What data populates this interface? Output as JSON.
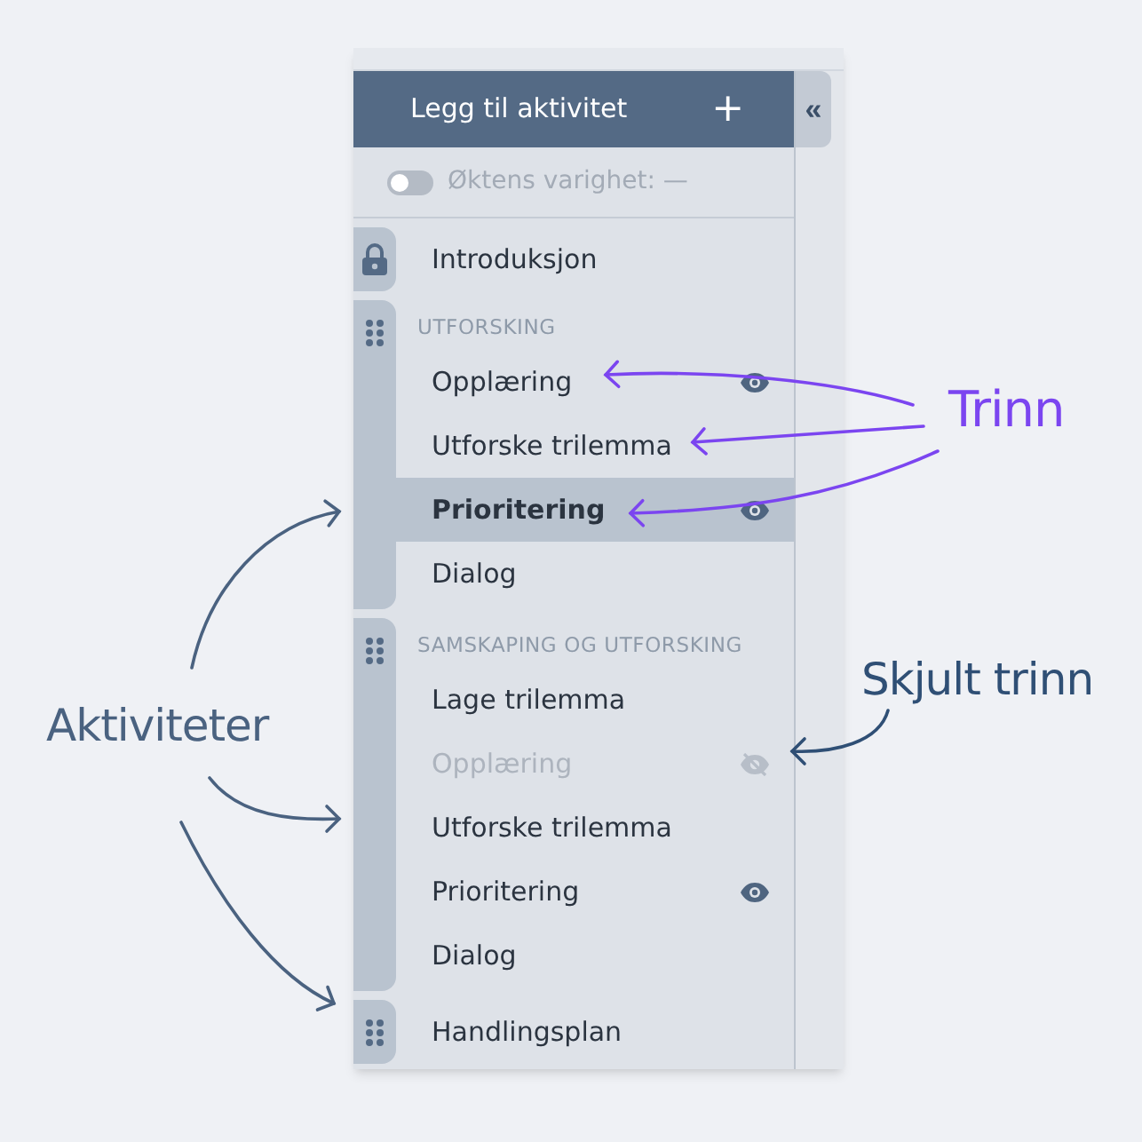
{
  "header": {
    "title": "Legg til aktivitet",
    "add_icon": "+",
    "collapse_icon": "«"
  },
  "duration_toggle": {
    "on": false,
    "label": "Øktens varighet: —"
  },
  "activities": [
    {
      "kind": "locked",
      "steps": [
        {
          "label": "Introduksjon",
          "eye_icon": false,
          "hidden": false,
          "selected": false
        }
      ]
    },
    {
      "kind": "group",
      "title": "UTFORSKING",
      "steps": [
        {
          "label": "Opplæring",
          "eye_icon": true,
          "hidden": false,
          "selected": false
        },
        {
          "label": "Utforske trilemma",
          "eye_icon": false,
          "hidden": false,
          "selected": false
        },
        {
          "label": "Prioritering",
          "eye_icon": true,
          "hidden": false,
          "selected": true
        },
        {
          "label": "Dialog",
          "eye_icon": false,
          "hidden": false,
          "selected": false
        }
      ]
    },
    {
      "kind": "group",
      "title": "SAMSKAPING OG UTFORSKING",
      "steps": [
        {
          "label": "Lage trilemma",
          "eye_icon": false,
          "hidden": false,
          "selected": false
        },
        {
          "label": "Opplæring",
          "eye_icon": true,
          "hidden": true,
          "selected": false
        },
        {
          "label": "Utforske trilemma",
          "eye_icon": false,
          "hidden": false,
          "selected": false
        },
        {
          "label": "Prioritering",
          "eye_icon": true,
          "hidden": false,
          "selected": false
        },
        {
          "label": "Dialog",
          "eye_icon": false,
          "hidden": false,
          "selected": false
        }
      ]
    },
    {
      "kind": "single",
      "steps": [
        {
          "label": "Handlingsplan",
          "eye_icon": false,
          "hidden": false,
          "selected": false
        }
      ]
    }
  ],
  "annotations": [
    {
      "text": "Trinn",
      "color": "#7b45f0"
    },
    {
      "text": "Skjult trinn",
      "color": "#2f4f75"
    },
    {
      "text": "Aktiviteter",
      "color": "#4a6280"
    }
  ]
}
